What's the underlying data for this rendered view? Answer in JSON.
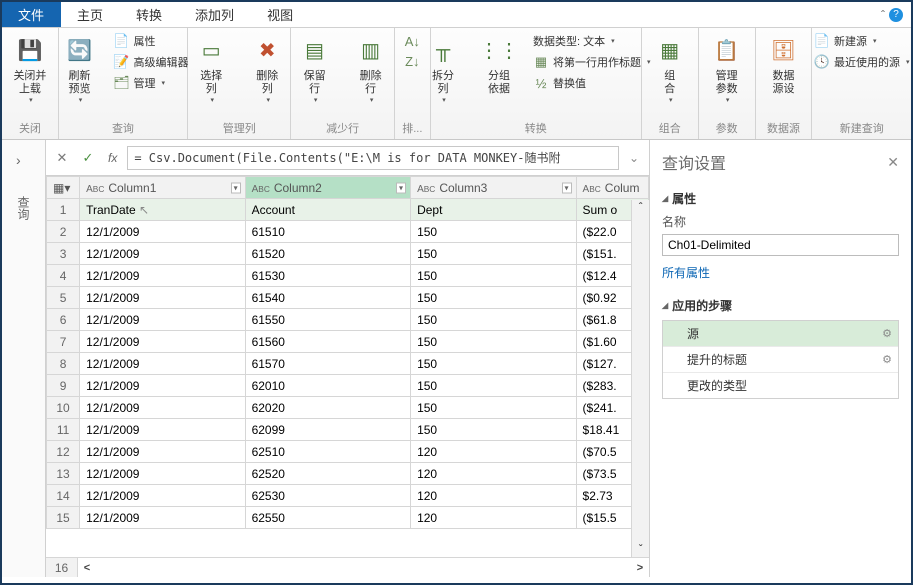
{
  "tabs": {
    "file": "文件",
    "home": "主页",
    "transform": "转换",
    "addcol": "添加列",
    "view": "视图"
  },
  "ribbon": {
    "close_group": "关闭",
    "close_load": "关闭并\n上载",
    "refresh": "刷新\n预览",
    "query_group": "查询",
    "props": "属性",
    "adveditor": "高级编辑器",
    "manage": "管理",
    "choose_cols": "选择\n列",
    "remove_cols": "删除\n列",
    "manage_cols_group": "管理列",
    "keep_rows": "保留\n行",
    "remove_rows": "删除\n行",
    "reduce_group": "减少行",
    "sort_group": "排...",
    "split_col": "拆分\n列",
    "groupby": "分组\n依据",
    "datatype_label": "数据类型: 文本",
    "first_row_header": "将第一行用作标题",
    "replace": "替换值",
    "transform_group": "转换",
    "combine": "组\n合",
    "combine_group": "组合",
    "manage_params": "管理\n参数",
    "params_group": "参数",
    "datasource": "数据\n源设",
    "datasource_group": "数据源",
    "newsource": "新建源",
    "recent": "最近使用的源",
    "newquery_group": "新建查询"
  },
  "leftRail": {
    "label": "查询"
  },
  "formula": "= Csv.Document(File.Contents(\"E:\\M is for DATA MONKEY-随书附",
  "columns": [
    "Column1",
    "Column2",
    "Column3",
    "Colum"
  ],
  "rows": [
    {
      "n": "1",
      "c1": "TranDate",
      "c2": "Account",
      "c3": "Dept",
      "c4": "Sum o"
    },
    {
      "n": "2",
      "c1": "12/1/2009",
      "c2": "61510",
      "c3": "150",
      "c4": "($22.0"
    },
    {
      "n": "3",
      "c1": "12/1/2009",
      "c2": "61520",
      "c3": "150",
      "c4": "($151."
    },
    {
      "n": "4",
      "c1": "12/1/2009",
      "c2": "61530",
      "c3": "150",
      "c4": "($12.4"
    },
    {
      "n": "5",
      "c1": "12/1/2009",
      "c2": "61540",
      "c3": "150",
      "c4": "($0.92"
    },
    {
      "n": "6",
      "c1": "12/1/2009",
      "c2": "61550",
      "c3": "150",
      "c4": "($61.8"
    },
    {
      "n": "7",
      "c1": "12/1/2009",
      "c2": "61560",
      "c3": "150",
      "c4": "($1.60"
    },
    {
      "n": "8",
      "c1": "12/1/2009",
      "c2": "61570",
      "c3": "150",
      "c4": "($127."
    },
    {
      "n": "9",
      "c1": "12/1/2009",
      "c2": "62010",
      "c3": "150",
      "c4": "($283."
    },
    {
      "n": "10",
      "c1": "12/1/2009",
      "c2": "62020",
      "c3": "150",
      "c4": "($241."
    },
    {
      "n": "11",
      "c1": "12/1/2009",
      "c2": "62099",
      "c3": "150",
      "c4": "$18.41"
    },
    {
      "n": "12",
      "c1": "12/1/2009",
      "c2": "62510",
      "c3": "120",
      "c4": "($70.5"
    },
    {
      "n": "13",
      "c1": "12/1/2009",
      "c2": "62520",
      "c3": "120",
      "c4": "($73.5"
    },
    {
      "n": "14",
      "c1": "12/1/2009",
      "c2": "62530",
      "c3": "120",
      "c4": "$2.73"
    },
    {
      "n": "15",
      "c1": "12/1/2009",
      "c2": "62550",
      "c3": "120",
      "c4": "($15.5"
    },
    {
      "n": "16",
      "c1": "",
      "c2": "",
      "c3": "",
      "c4": ""
    }
  ],
  "panel": {
    "title": "查询设置",
    "props_section": "属性",
    "name_label": "名称",
    "name_value": "Ch01-Delimited",
    "all_props": "所有属性",
    "steps_section": "应用的步骤",
    "steps": [
      "源",
      "提升的标题",
      "更改的类型"
    ]
  }
}
